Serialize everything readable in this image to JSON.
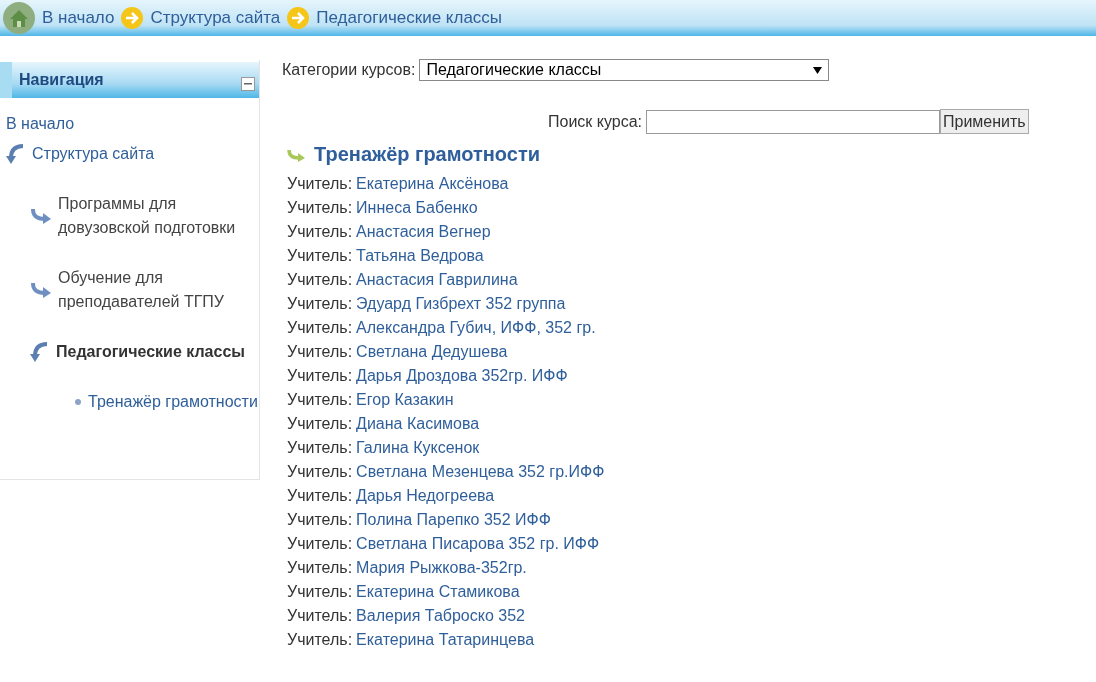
{
  "breadcrumb": [
    {
      "label": "В начало",
      "kind": "home"
    },
    {
      "label": "Структура сайта",
      "kind": "step"
    },
    {
      "label": "Педагогические классы",
      "kind": "step"
    }
  ],
  "navigation": {
    "title": "Навигация",
    "items": [
      {
        "label": "В начало",
        "kind": "link",
        "selected": false
      },
      {
        "label": "Структура сайта",
        "kind": "expanded",
        "selected": false,
        "children": [
          {
            "label": "Программы для довузовской подготовки",
            "kind": "collapsed",
            "selected": false
          },
          {
            "label": "Обучение для преподавателей ТГПУ",
            "kind": "collapsed",
            "selected": false
          },
          {
            "label": "Педагогические классы",
            "kind": "expanded",
            "selected": true,
            "children": [
              {
                "label": "Тренажёр грамотности",
                "kind": "leaf",
                "selected": false
              }
            ]
          }
        ]
      }
    ]
  },
  "category": {
    "label": "Категории курсов:",
    "value": "Педагогические классы"
  },
  "search": {
    "label": "Поиск курса:",
    "button": "Применить"
  },
  "course": {
    "title": "Тренажёр грамотности",
    "teachers": [
      {
        "label": "Учитель:",
        "name": "Екатерина Аксёнова"
      },
      {
        "label": "Учитель:",
        "name": "Иннеса Бабенко"
      },
      {
        "label": "Учитель:",
        "name": "Анастасия Вегнер"
      },
      {
        "label": "Учитель:",
        "name": "Татьяна Ведрова"
      },
      {
        "label": "Учитель:",
        "name": "Анастасия Гаврилина"
      },
      {
        "label": "Учитель:",
        "name": "Эдуард Гизбрехт 352 группа"
      },
      {
        "label": "Учитель:",
        "name": "Александра Губич, ИФФ, 352 гр."
      },
      {
        "label": "Учитель:",
        "name": "Светлана Дедушева"
      },
      {
        "label": "Учитель:",
        "name": "Дарья Дроздова 352гр. ИФФ"
      },
      {
        "label": "Учитель:",
        "name": "Егор Казакин"
      },
      {
        "label": "Учитель:",
        "name": "Диана Касимова"
      },
      {
        "label": "Учитель:",
        "name": "Галина Куксенок"
      },
      {
        "label": "Учитель:",
        "name": "Светлана Мезенцева 352 гр.ИФФ"
      },
      {
        "label": "Учитель:",
        "name": "Дарья Недогреева"
      },
      {
        "label": "Учитель:",
        "name": "Полина Парепко 352 ИФФ"
      },
      {
        "label": "Учитель:",
        "name": "Светлана Писарова 352 гр. ИФФ"
      },
      {
        "label": "Учитель:",
        "name": "Мария Рыжкова-352гр."
      },
      {
        "label": "Учитель:",
        "name": "Екатерина Стамикова"
      },
      {
        "label": "Учитель:",
        "name": "Валерия Таброско 352"
      },
      {
        "label": "Учитель:",
        "name": "Екатерина Татаринцева"
      }
    ]
  }
}
